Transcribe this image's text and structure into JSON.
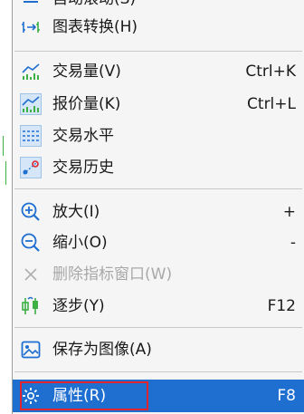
{
  "menu": {
    "cut_top_label": "自动滚动(S)",
    "chart_switch": {
      "label": "图表转换(H)",
      "icon": "chart-switch-icon"
    },
    "volume": {
      "label": "交易量(V)",
      "shortcut": "Ctrl+K",
      "icon": "volume-bars-icon"
    },
    "quote_volume": {
      "label": "报价量(K)",
      "shortcut": "Ctrl+L",
      "icon": "quote-volume-icon"
    },
    "trade_level": {
      "label": "交易水平",
      "icon": "dashed-lines-icon"
    },
    "trade_history": {
      "label": "交易历史",
      "icon": "trade-history-icon"
    },
    "zoom_in": {
      "label": "放大(I)",
      "shortcut": "+",
      "icon": "zoom-in-icon"
    },
    "zoom_out": {
      "label": "缩小(O)",
      "shortcut": "-",
      "icon": "zoom-out-icon"
    },
    "delete_indicator": {
      "label": "删除指标窗口(W)",
      "icon": "close-x-icon"
    },
    "step": {
      "label": "逐步(Y)",
      "shortcut": "F12",
      "icon": "step-icon"
    },
    "save_image": {
      "label": "保存为图像(A)",
      "icon": "image-icon"
    },
    "properties": {
      "label": "属性(R)",
      "shortcut": "F8",
      "icon": "gear-icon"
    }
  },
  "colors": {
    "accent": "#1f6fd1",
    "highlight_border": "#e0242f",
    "icon_blue": "#1f6fd1",
    "chart_green": "#3cb043"
  }
}
